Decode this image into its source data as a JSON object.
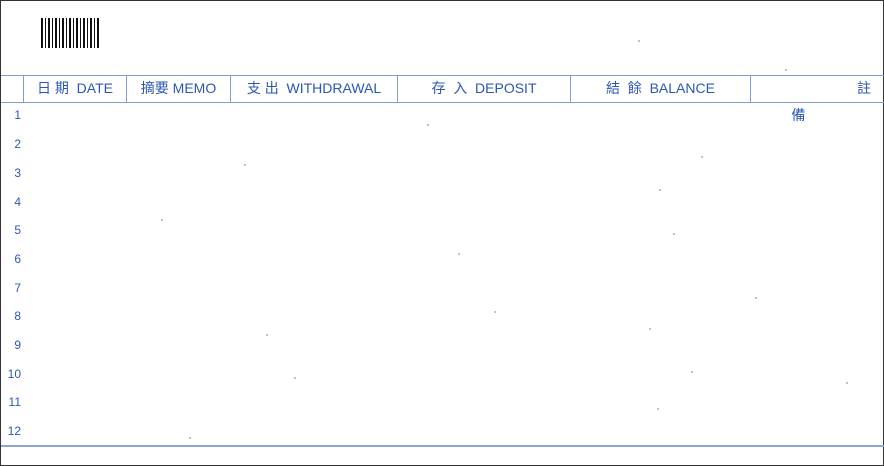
{
  "columns": [
    {
      "text": "日 期  DATE"
    },
    {
      "text": "摘要 MEMO"
    },
    {
      "text": "支 出  WITHDRAWAL"
    },
    {
      "text": "存  入  DEPOSIT"
    },
    {
      "text": "結  餘  BALANCE"
    },
    {
      "left": "備",
      "right": "註"
    }
  ],
  "rows": [
    "1",
    "2",
    "3",
    "4",
    "5",
    "6",
    "7",
    "8",
    "9",
    "10",
    "11",
    "12"
  ],
  "colors": {
    "ink": "#2b57b4",
    "rule": "#7f9fcf"
  }
}
